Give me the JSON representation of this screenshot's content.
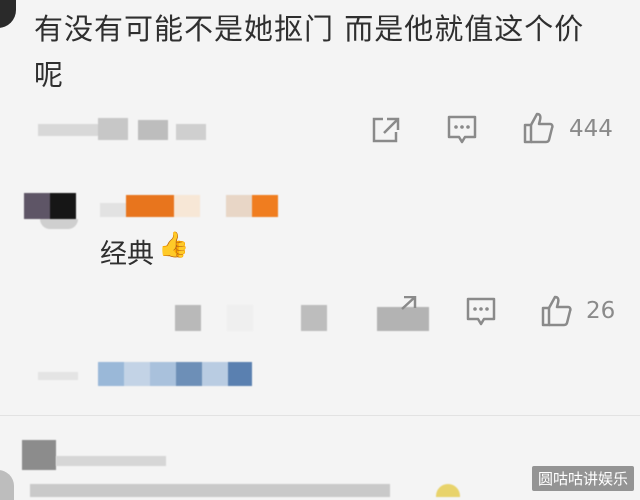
{
  "comment": {
    "text_line1": "有没有可能不是她抠门 而是他就值这个价",
    "text_line2": "呢",
    "like_count": "444"
  },
  "reply": {
    "text": "经典",
    "emoji": "👍",
    "like_count": "26"
  },
  "watermark": "圆咕咕讲娱乐",
  "colors": {
    "background": "#f4f4f4",
    "icon": "#8a8a8a",
    "text": "#2f2f2f"
  }
}
